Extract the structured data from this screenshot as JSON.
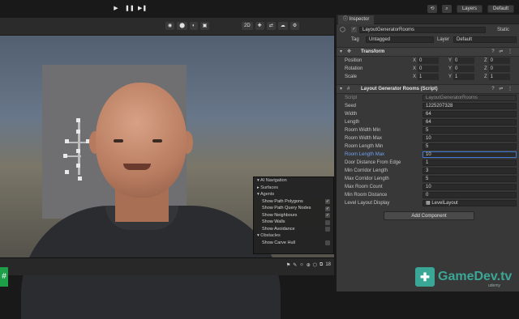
{
  "topbar": {
    "play_icons": [
      "▶",
      "❚❚",
      "▶❚"
    ],
    "history_icon": "⟲",
    "search_icon": "⌕",
    "layers_label": "Layers",
    "layout_label": "Default"
  },
  "scene_toolbar": {
    "left_icons": [
      "◉",
      "⬤",
      "◐",
      "▣"
    ],
    "mode_2d": "2D",
    "right_icons": [
      "✚",
      "⇄",
      "☁",
      "⚙"
    ]
  },
  "ai_navigation": {
    "title": "AI Navigation",
    "surfaces": "Surfaces",
    "agents": "Agents",
    "agent_items": [
      {
        "label": "Show Path Polygons",
        "checked": true
      },
      {
        "label": "Show Path Query Nodes",
        "checked": true
      },
      {
        "label": "Show Neighbours",
        "checked": true
      },
      {
        "label": "Show Walls",
        "checked": false
      },
      {
        "label": "Show Avoidance",
        "checked": false
      }
    ],
    "obstacles": "Obstacles",
    "obstacle_items": [
      {
        "label": "Show Carve Hull",
        "checked": false
      }
    ]
  },
  "scene_bottom": {
    "icons": [
      "⚑",
      "✎",
      "☼",
      "⊕",
      "⬡",
      "⧉"
    ],
    "count": "18"
  },
  "inspector": {
    "tab_label": "Inspector",
    "object_name": "LayoutGeneratorRooms",
    "static_label": "Static",
    "tag_label": "Tag",
    "tag_value": "Untagged",
    "layer_label": "Layer",
    "layer_value": "Default",
    "transform": {
      "title": "Transform",
      "rows": [
        {
          "label": "Position",
          "x": "0",
          "y": "0",
          "z": "0"
        },
        {
          "label": "Rotation",
          "x": "0",
          "y": "0",
          "z": "0"
        },
        {
          "label": "Scale",
          "x": "1",
          "y": "1",
          "z": "1"
        }
      ]
    },
    "script_component": {
      "title": "Layout Generator Rooms (Script)",
      "script_label": "Script",
      "script_value": "LayoutGeneratorRooms",
      "fields": [
        {
          "label": "Seed",
          "value": "1225207328"
        },
        {
          "label": "Width",
          "value": "64"
        },
        {
          "label": "Length",
          "value": "64"
        },
        {
          "label": "Room Width Min",
          "value": "5"
        },
        {
          "label": "Room Width Max",
          "value": "10"
        },
        {
          "label": "Room Length Min",
          "value": "5"
        },
        {
          "label": "Room Length Max",
          "value": "10"
        },
        {
          "label": "Door Distance From Edge",
          "value": "1"
        },
        {
          "label": "Min Corridor Length",
          "value": "3"
        },
        {
          "label": "Max Corridor Length",
          "value": "5"
        },
        {
          "label": "Max Room Count",
          "value": "10"
        },
        {
          "label": "Min Room Distance",
          "value": "0"
        },
        {
          "label": "Level Layout Display",
          "value": "LevelLayout"
        }
      ]
    },
    "add_component": "Add Component"
  },
  "branding": {
    "logo_text": "GameDev.tv",
    "sub_text": "udemy"
  },
  "colors": {
    "accent_teal": "#3aa796",
    "editor_bg": "#383838",
    "selected_field": "#3d7bd6"
  }
}
